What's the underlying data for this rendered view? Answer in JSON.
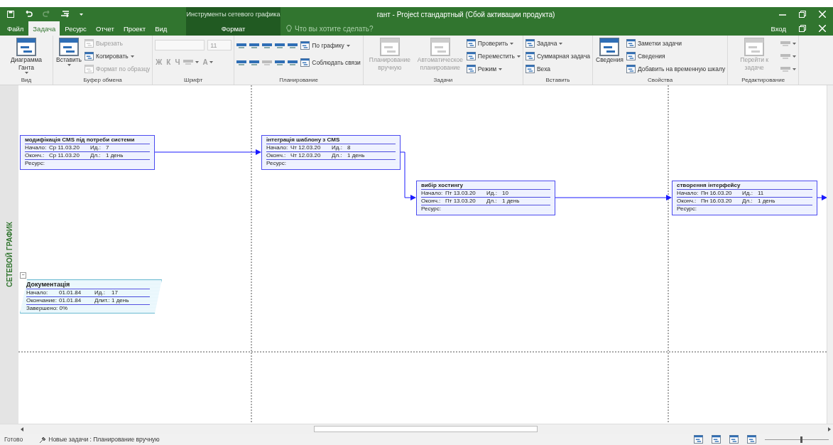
{
  "title_bar": {
    "context_group": "Инструменты сетевого графика",
    "title": "гант - Project стандартный (Сбой активации продукта)"
  },
  "tabs": [
    {
      "label": "Файл",
      "selected": false
    },
    {
      "label": "Задача",
      "selected": true
    },
    {
      "label": "Ресурс",
      "selected": false
    },
    {
      "label": "Отчет",
      "selected": false
    },
    {
      "label": "Проект",
      "selected": false
    },
    {
      "label": "Вид",
      "selected": false
    }
  ],
  "context_tabs": [
    {
      "label": "Формат",
      "selected": false
    }
  ],
  "tell_me": {
    "placeholder": "Что вы хотите сделать?"
  },
  "sign_in": "Вход",
  "ribbon": [
    {
      "label": "Вид",
      "stacks": [
        {
          "kind": "large",
          "items": [
            {
              "label": "Диаграмма Ганта",
              "disabled": false,
              "dropdown": true
            }
          ]
        }
      ]
    },
    {
      "label": "Буфер обмена",
      "stacks": [
        {
          "kind": "large",
          "items": [
            {
              "label": "Вставить",
              "disabled": false,
              "dropdown": true
            }
          ]
        },
        {
          "kind": "column",
          "items": [
            {
              "kind": "button",
              "label": "Вырезать",
              "disabled": true,
              "dropdown": false
            },
            {
              "kind": "button",
              "label": "Копировать",
              "disabled": false,
              "dropdown": true
            },
            {
              "kind": "button",
              "label": "Формат по образцу",
              "disabled": true,
              "dropdown": false
            }
          ]
        }
      ]
    },
    {
      "label": "Шрифт",
      "stacks": [
        {
          "kind": "lines",
          "lines": [
            {
              "items": [
                {
                  "kind": "field",
                  "disabled": true
                },
                {
                  "kind": "field",
                  "value": "11",
                  "disabled": true
                }
              ]
            },
            {
              "items": [
                {
                  "kind": "glyph",
                  "label": "Ж",
                  "disabled": true
                },
                {
                  "kind": "glyph",
                  "label": "К",
                  "disabled": true
                },
                {
                  "kind": "glyph",
                  "label": "Ч",
                  "disabled": true
                },
                {
                  "kind": "icon",
                  "disabled": true,
                  "dropdown": true
                },
                {
                  "kind": "glyph",
                  "label": "А",
                  "disabled": true,
                  "dropdown": true
                }
              ]
            }
          ]
        }
      ]
    },
    {
      "label": "Планирование",
      "stacks": [
        {
          "kind": "lines",
          "lines": [
            {
              "items": [
                {
                  "kind": "icon",
                  "disabled": false
                },
                {
                  "kind": "icon",
                  "disabled": false
                },
                {
                  "kind": "icon",
                  "disabled": false
                },
                {
                  "kind": "icon",
                  "disabled": false
                },
                {
                  "kind": "icon",
                  "disabled": false
                },
                {
                  "kind": "button",
                  "label": "По графику",
                  "disabled": false,
                  "dropdown": true
                }
              ]
            },
            {
              "items": [
                {
                  "kind": "icon",
                  "disabled": false
                },
                {
                  "kind": "icon",
                  "disabled": false
                },
                {
                  "kind": "icon",
                  "disabled": true
                },
                {
                  "kind": "icon",
                  "disabled": false
                },
                {
                  "kind": "icon",
                  "disabled": false
                },
                {
                  "kind": "button",
                  "label": "Соблюдать связи",
                  "disabled": false,
                  "dropdown": false
                }
              ]
            }
          ]
        }
      ]
    },
    {
      "label": "Задачи",
      "stacks": [
        {
          "kind": "large",
          "items": [
            {
              "label": "Планирование вручную",
              "disabled": true,
              "dropdown": false
            }
          ]
        },
        {
          "kind": "large",
          "items": [
            {
              "label": "Автоматическое планирование",
              "disabled": true,
              "dropdown": false
            }
          ]
        },
        {
          "kind": "column",
          "items": [
            {
              "kind": "button",
              "label": "Проверить",
              "disabled": false,
              "dropdown": true
            },
            {
              "kind": "button",
              "label": "Переместить",
              "disabled": false,
              "dropdown": true
            },
            {
              "kind": "button",
              "label": "Режим",
              "disabled": false,
              "dropdown": true
            }
          ]
        }
      ]
    },
    {
      "label": "Вставить",
      "stacks": [
        {
          "kind": "column",
          "items": [
            {
              "kind": "button",
              "label": "Задача",
              "disabled": false,
              "dropdown": true
            },
            {
              "kind": "button",
              "label": "Суммарная задача",
              "disabled": false,
              "dropdown": false
            },
            {
              "kind": "button",
              "label": "Веха",
              "disabled": false,
              "dropdown": false
            }
          ]
        }
      ]
    },
    {
      "label": "Свойства",
      "stacks": [
        {
          "kind": "large",
          "items": [
            {
              "label": "Сведения",
              "disabled": false,
              "dropdown": false
            }
          ]
        },
        {
          "kind": "column",
          "items": [
            {
              "kind": "button",
              "label": "Заметки задачи",
              "disabled": false,
              "dropdown": false
            },
            {
              "kind": "button",
              "label": "Сведения",
              "disabled": false,
              "dropdown": false
            },
            {
              "kind": "button",
              "label": "Добавить на временную шкалу",
              "disabled": false,
              "dropdown": false
            }
          ]
        }
      ]
    },
    {
      "label": "Редактирование",
      "stacks": [
        {
          "kind": "large",
          "items": [
            {
              "label": "Перейти к задаче",
              "disabled": true,
              "dropdown": false
            }
          ]
        },
        {
          "kind": "column",
          "items": [
            {
              "kind": "icon",
              "disabled": true,
              "dropdown": true
            },
            {
              "kind": "icon",
              "disabled": true,
              "dropdown": true
            },
            {
              "kind": "icon",
              "disabled": true,
              "dropdown": true
            }
          ]
        }
      ]
    }
  ],
  "view_label": "СЕТЕВОЙ ГРАФИК",
  "nodes": [
    {
      "kind": "task",
      "title": "модифікація CMS під потреби системи",
      "start_label": "Начало:",
      "start": "Ср 11.03.20",
      "id_label": "Ид.:",
      "id": "7",
      "finish_label": "Оконч.:",
      "finish": "Ср 11.03.20",
      "duration_label": "Дл.:",
      "duration": "1 день",
      "resource_label": "Ресурс:"
    },
    {
      "kind": "task",
      "title": "інтеграція шаблону з CMS",
      "start_label": "Начало:",
      "start": "Чт 12.03.20",
      "id_label": "Ид.:",
      "id": "8",
      "finish_label": "Оконч.:",
      "finish": "Чт 12.03.20",
      "duration_label": "Дл.:",
      "duration": "1 день",
      "resource_label": "Ресурс:"
    },
    {
      "kind": "task",
      "title": "вибір хостингу",
      "start_label": "Начало:",
      "start": "Пт 13.03.20",
      "id_label": "Ид.:",
      "id": "10",
      "finish_label": "Оконч.:",
      "finish": "Пт 13.03.20",
      "duration_label": "Дл.:",
      "duration": "1 день",
      "resource_label": "Ресурс:"
    },
    {
      "kind": "task",
      "title": "створення інтерфейсу",
      "start_label": "Начало:",
      "start": "Пн 16.03.20",
      "id_label": "Ид.:",
      "id": "11",
      "finish_label": "Оконч.:",
      "finish": "Пн 16.03.20",
      "duration_label": "Дл.:",
      "duration": "1 день",
      "resource_label": "Ресурс:"
    },
    {
      "kind": "summary",
      "collapse": "−",
      "title": "Документація",
      "start_label": "Начало:",
      "start": "01.01.84",
      "id_label": "Ид.:",
      "id": "17",
      "finish_label": "Окончание:",
      "finish": "01.01.84",
      "duration_label": "Длит.:",
      "duration": "1 день",
      "complete": "Завершено: 0%"
    }
  ],
  "status_bar": {
    "ready": "Готово",
    "new_tasks": "Новые задачи : Планирование вручную",
    "zoom": {
      "level": 0.55
    }
  }
}
